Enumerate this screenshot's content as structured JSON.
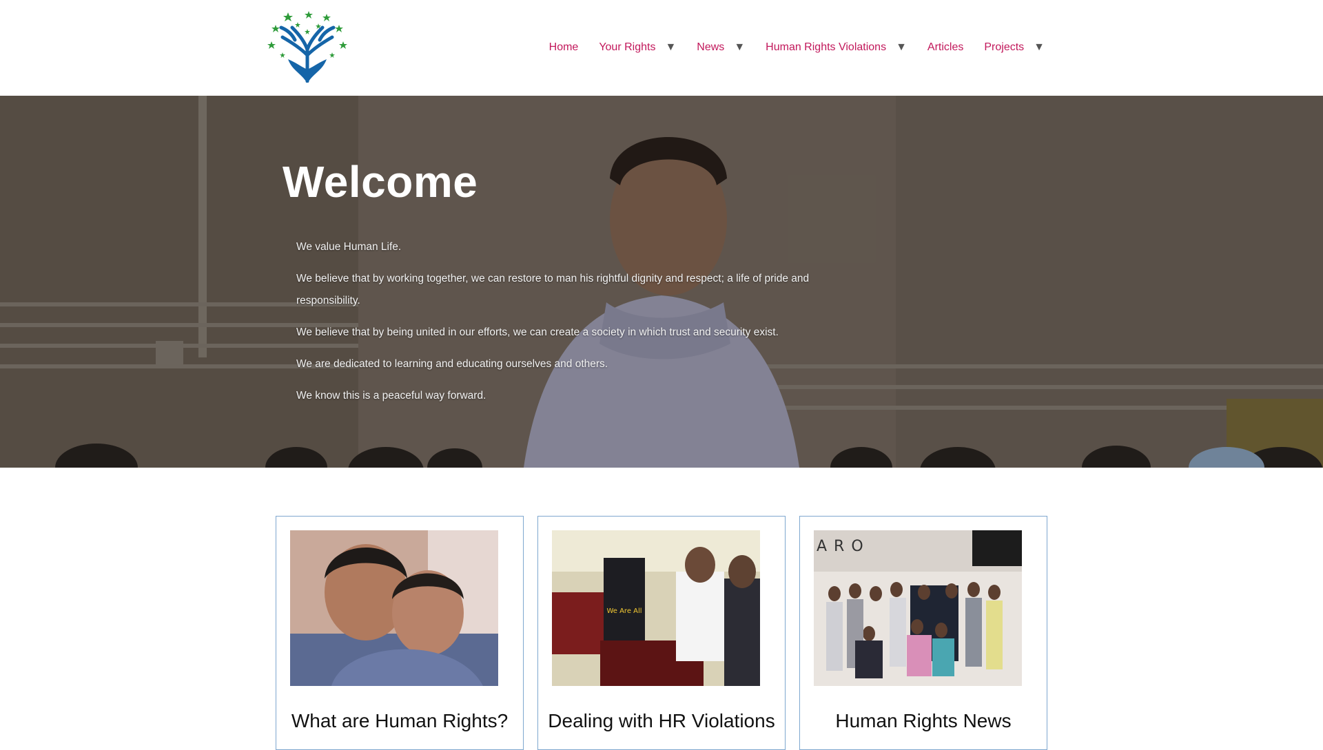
{
  "header": {
    "logo_icon": "tree-hands-logo",
    "nav": [
      {
        "label": "Home",
        "dropdown": false
      },
      {
        "label": "Your Rights",
        "dropdown": true
      },
      {
        "label": "News",
        "dropdown": true
      },
      {
        "label": "Human Rights Violations",
        "dropdown": true
      },
      {
        "label": "Articles",
        "dropdown": false
      },
      {
        "label": "Projects",
        "dropdown": true
      }
    ],
    "caret": "▼"
  },
  "hero": {
    "title": "Welcome",
    "paragraphs": [
      "We value Human Life.",
      "We believe that by working together, we can restore to man his rightful dignity and respect; a life of pride and responsibility.",
      "We believe that by being united in our efforts, we can create a society in which trust and security exist.",
      "We are dedicated to learning and educating ourselves and others.",
      "We know this is a peaceful way forward."
    ]
  },
  "cards": [
    {
      "title": "What are Human Rights?",
      "image": "two-boys-photo"
    },
    {
      "title": "Dealing with HR Violations",
      "image": "youth-workshop-photo"
    },
    {
      "title": "Human Rights News",
      "image": "group-photo"
    }
  ],
  "colors": {
    "nav_link": "#c2185b",
    "card_border": "#7ea7cf",
    "logo_blue": "#1565a8",
    "logo_green": "#2e9b3a"
  }
}
